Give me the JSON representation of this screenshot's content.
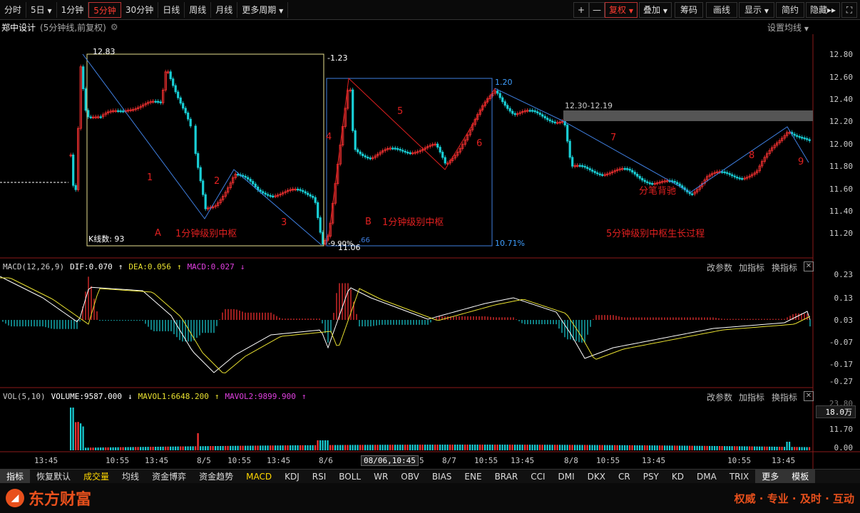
{
  "periods": [
    "分时",
    "5日",
    "1分钟",
    "5分钟",
    "30分钟",
    "日线",
    "周线",
    "月线",
    "更多周期"
  ],
  "toolbar": {
    "plus": "+",
    "minus": "—",
    "fuquan": "复权",
    "diejia": "叠加",
    "chouma": "筹码",
    "huaxian": "画线",
    "xianshi": "显示",
    "jianyue": "简约",
    "yincang": "隐藏",
    "fwd": "▸▸"
  },
  "stock": {
    "name": "郑中设计",
    "info": "(5分钟线,前复权)",
    "setma": "设置均线"
  },
  "price_axis": [
    "12.80",
    "12.60",
    "12.40",
    "12.20",
    "12.00",
    "11.80",
    "11.60",
    "11.40",
    "11.20"
  ],
  "annotations": {
    "high": "12.83",
    "hi_pct": "-1.23",
    "low": "11.06",
    "low_pct": "-9.90%",
    "k_count": "K线数: 93",
    "box1_label": "A",
    "box1_text": "1分钟级别中枢",
    "box2_label": "B",
    "box2_text": "1分钟级别中枢",
    "box2_high": "1.20",
    "box2_pct": "10.71%",
    "box2_low": ".66",
    "range": "12.30-12.19",
    "divergence": "分笔背驰",
    "growth": "5分钟级别中枢生长过程",
    "seg": [
      "1",
      "2",
      "3",
      "4",
      "5",
      "6",
      "7",
      "8",
      "9"
    ]
  },
  "macd": {
    "title": "MACD(12,26,9)",
    "dif": "DIF:0.070",
    "dea": "DEA:0.056",
    "macd": "MACD:0.027",
    "axis": [
      "0.23",
      "0.13",
      "0.03",
      "-0.07",
      "-0.17",
      "-0.27"
    ],
    "btn1": "改参数",
    "btn2": "加指标",
    "btn3": "换指标"
  },
  "vol": {
    "title": "VOL(5,10)",
    "volume": "VOLUME:9587.000",
    "mavol1": "MAVOL1:6648.200",
    "mavol2": "MAVOL2:9899.900",
    "axis_top": "23.80",
    "axis_badge": "18.0万",
    "axis": [
      "11.70",
      "0.00"
    ],
    "btn1": "改参数",
    "btn2": "加指标",
    "btn3": "换指标"
  },
  "time_axis": [
    "13:45",
    "10:55",
    "13:45",
    "8/5",
    "10:55",
    "13:45",
    "8/6",
    "08/06,10:45",
    "5",
    "8/7",
    "10:55",
    "13:45",
    "8/8",
    "10:55",
    "13:45",
    "10:55",
    "13:45"
  ],
  "indicators": [
    "指标",
    "恢复默认",
    "成交量",
    "均线",
    "资金博弈",
    "资金趋势",
    "MACD",
    "KDJ",
    "RSI",
    "BOLL",
    "WR",
    "OBV",
    "BIAS",
    "ENE",
    "BRAR",
    "CCI",
    "DMI",
    "DKX",
    "CR",
    "PSY",
    "KD",
    "DMA",
    "TRIX",
    "更多",
    "模板"
  ],
  "footer": {
    "logo": "东方财富",
    "slogan": "权威 · 专业 · 及时 · 互动"
  },
  "colors": {
    "up": "#ff3333",
    "down": "#19cfd6",
    "box1": "#e8e090",
    "box2": "#3f7fe0",
    "annot": "#e02020",
    "dif": "#ffffff",
    "dea": "#e8e030"
  }
}
